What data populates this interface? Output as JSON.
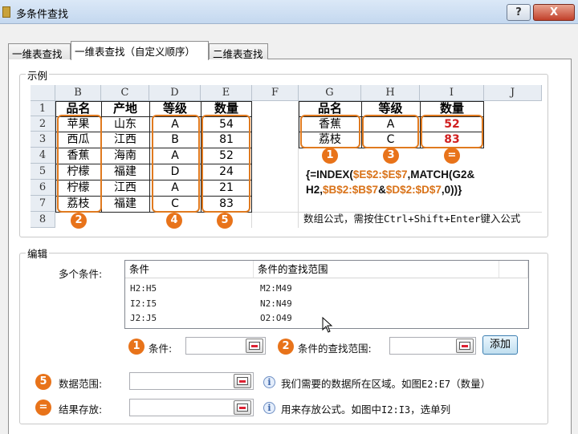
{
  "window": {
    "title": "多条件查找",
    "help_label": "?",
    "close_label": "X"
  },
  "tabs": [
    {
      "label": "一维表查找"
    },
    {
      "label": "一维表查找（自定义顺序）"
    },
    {
      "label": "二维表查找"
    }
  ],
  "example": {
    "group_label": "示例",
    "columns": [
      "B",
      "C",
      "D",
      "E",
      "F",
      "G",
      "H",
      "I",
      "J"
    ],
    "rows": [
      "1",
      "2",
      "3",
      "4",
      "5",
      "6",
      "7",
      "8"
    ],
    "left_table": {
      "headers": [
        "品名",
        "产地",
        "等级",
        "数量"
      ],
      "rows": [
        [
          "苹果",
          "山东",
          "A",
          "54"
        ],
        [
          "西瓜",
          "江西",
          "B",
          "81"
        ],
        [
          "香蕉",
          "海南",
          "A",
          "52"
        ],
        [
          "柠檬",
          "福建",
          "D",
          "24"
        ],
        [
          "柠檬",
          "江西",
          "A",
          "21"
        ],
        [
          "荔枝",
          "福建",
          "C",
          "83"
        ]
      ]
    },
    "right_table": {
      "headers": [
        "品名",
        "等级",
        "数量"
      ],
      "rows": [
        [
          "香蕉",
          "A",
          "52"
        ],
        [
          "荔枝",
          "C",
          "83"
        ]
      ]
    },
    "badges": {
      "b1": "1",
      "b2": "2",
      "b3": "3",
      "b4": "4",
      "b5": "5",
      "beq": "="
    },
    "formula": {
      "p1": "{=INDEX(",
      "p2": "$E$2:$E$7",
      "p3": ",MATCH(G2&",
      "p4": "H2,",
      "p5": "$B$2:$B$7",
      "p6": "&",
      "p7": "$D$2:$D$7",
      "p8": ",0))}"
    },
    "note": "数组公式，需按住Ctrl+Shift+Enter键入公式"
  },
  "edit": {
    "group_label": "编辑",
    "multi_label": "多个条件:",
    "list": {
      "headers": [
        "条件",
        "条件的查找范围"
      ],
      "rows": [
        [
          "H2:H5",
          "M2:M49"
        ],
        [
          "I2:I5",
          "N2:N49"
        ],
        [
          "J2:J5",
          "O2:O49"
        ]
      ]
    },
    "badge1": "1",
    "cond_label": "条件:",
    "badge2": "2",
    "range_label": "条件的查找范围:",
    "add_button": "添加",
    "badge5": "5",
    "data_range_label": "数据范围:",
    "data_info_a": "我们需要的数据所在区域。如图",
    "data_info_b": "E2:E7",
    "data_info_c": "（数量）",
    "badgeeq": "=",
    "result_label": "结果存放:",
    "result_info_a": "用来存放公式。如图中",
    "result_info_b": "I2:I3",
    "result_info_c": "，选单列",
    "info_glyph": "i"
  }
}
